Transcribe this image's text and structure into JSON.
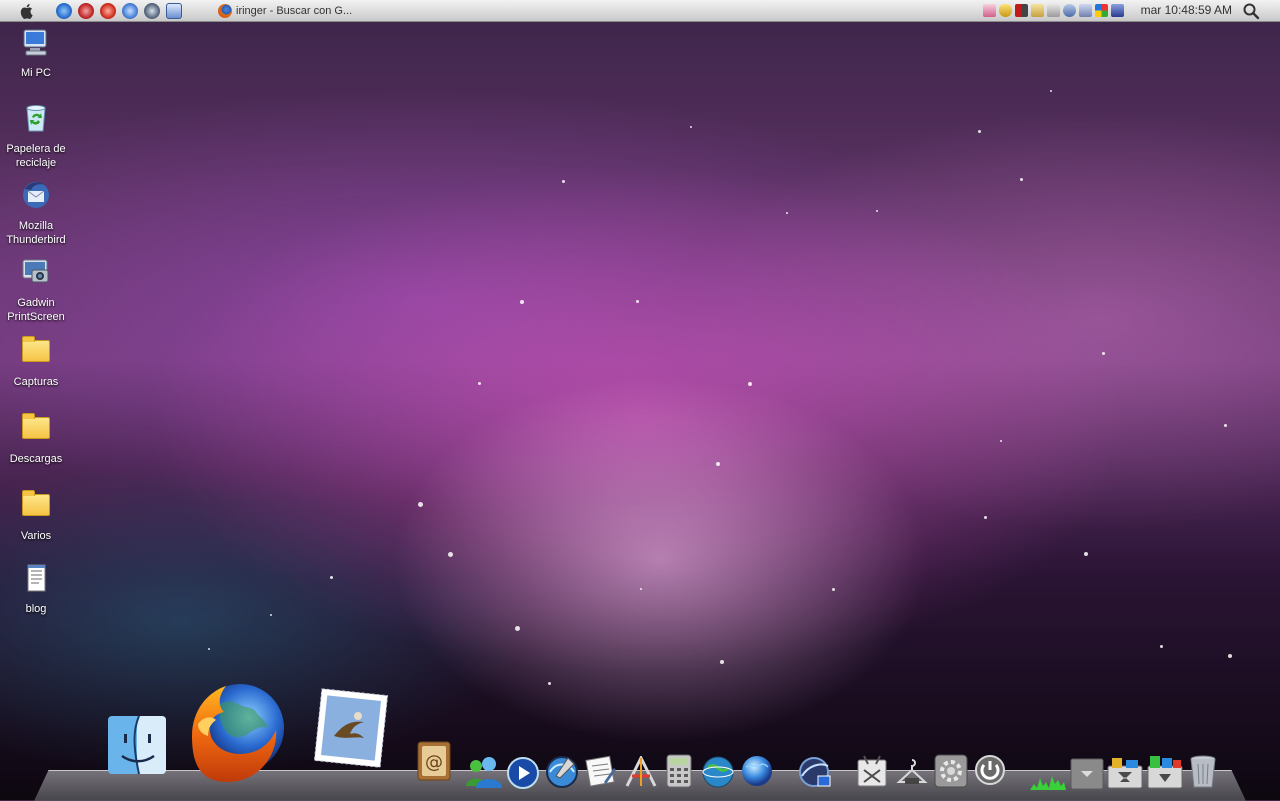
{
  "menubar": {
    "apple_icon": "apple-icon",
    "quick_launch": [
      "ie-icon",
      "opera-icon",
      "reload-icon",
      "messenger-icon",
      "media-icon",
      "notepad-icon"
    ],
    "task": {
      "icon": "firefox-icon",
      "title": "iringer - Buscar con G..."
    },
    "tray_icons": [
      "shield-icon",
      "security-icon",
      "flag-icon",
      "battery-icon",
      "volume-icon",
      "network-icon",
      "monitor-icon",
      "windows-icon",
      "display-icon"
    ],
    "clock": "mar 10:48:59 AM",
    "search_icon": "magnifier-icon"
  },
  "desktop": [
    {
      "label": "Mi PC",
      "icon": "computer-icon"
    },
    {
      "label": "Papelera de reciclaje",
      "icon": "recycle-bin-icon"
    },
    {
      "label": "Mozilla Thunderbird",
      "icon": "thunderbird-icon"
    },
    {
      "label": "Gadwin PrintScreen",
      "icon": "printscreen-icon"
    },
    {
      "label": "Capturas",
      "icon": "folder-icon"
    },
    {
      "label": "Descargas",
      "icon": "folder-icon"
    },
    {
      "label": "Varios",
      "icon": "folder-icon"
    },
    {
      "label": "blog",
      "icon": "text-file-icon"
    }
  ],
  "dock": [
    "finder-icon",
    "firefox-icon",
    "mail-icon",
    "address-book-icon",
    "messenger-icon",
    "media-player-icon",
    "itunes-icon",
    "textedit-icon",
    "app-store-icon",
    "calculator-icon",
    "network-globe-icon",
    "safari-icon",
    "dashboard-icon",
    "utility-icon",
    "hanger-icon",
    "system-preferences-icon",
    "power-icon",
    "activity-monitor-icon",
    "stack-icon",
    "downloads-icon",
    "applications-icon",
    "trash-icon"
  ]
}
